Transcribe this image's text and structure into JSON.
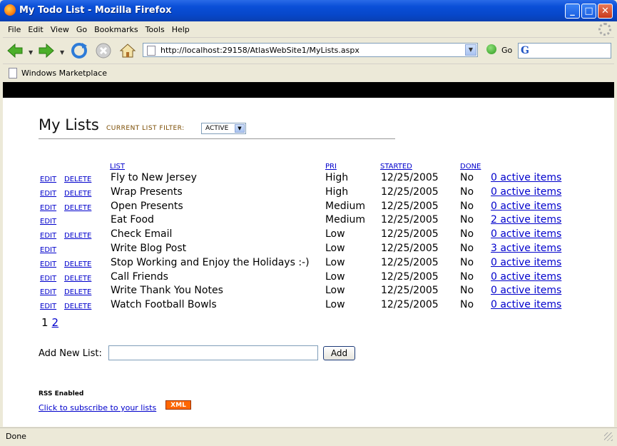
{
  "window": {
    "title": "My Todo List - Mozilla Firefox"
  },
  "menu": [
    "File",
    "Edit",
    "View",
    "Go",
    "Bookmarks",
    "Tools",
    "Help"
  ],
  "nav": {
    "url": "http://localhost:29158/AtlasWebSite1/MyLists.aspx",
    "go_label": "Go"
  },
  "bookmarks": {
    "item": "Windows Marketplace"
  },
  "page": {
    "title": "My Lists",
    "filter_label": "CURRENT LIST FILTER:",
    "filter_value": "ACTIVE",
    "columns": {
      "list": "LIST",
      "pri": "PRI",
      "started": "STARTED",
      "done": "DONE"
    },
    "edit_label": "EDIT",
    "delete_label": "DELETE",
    "rows": [
      {
        "name": "Fly to New Jersey",
        "pri": "High",
        "started": "12/25/2005",
        "done": "No",
        "items": "0 active items",
        "deletable": true
      },
      {
        "name": "Wrap Presents",
        "pri": "High",
        "started": "12/25/2005",
        "done": "No",
        "items": "0 active items",
        "deletable": true
      },
      {
        "name": "Open Presents",
        "pri": "Medium",
        "started": "12/25/2005",
        "done": "No",
        "items": "0 active items",
        "deletable": true
      },
      {
        "name": "Eat Food",
        "pri": "Medium",
        "started": "12/25/2005",
        "done": "No",
        "items": "2 active items",
        "deletable": false
      },
      {
        "name": "Check Email",
        "pri": "Low",
        "started": "12/25/2005",
        "done": "No",
        "items": "0 active items",
        "deletable": true
      },
      {
        "name": "Write Blog Post",
        "pri": "Low",
        "started": "12/25/2005",
        "done": "No",
        "items": "3 active items",
        "deletable": false
      },
      {
        "name": "Stop Working and Enjoy the Holidays :-)",
        "pri": "Low",
        "started": "12/25/2005",
        "done": "No",
        "items": "0 active items",
        "deletable": true
      },
      {
        "name": "Call Friends",
        "pri": "Low",
        "started": "12/25/2005",
        "done": "No",
        "items": "0 active items",
        "deletable": true
      },
      {
        "name": "Write Thank You Notes",
        "pri": "Low",
        "started": "12/25/2005",
        "done": "No",
        "items": "0 active items",
        "deletable": true
      },
      {
        "name": "Watch Football Bowls",
        "pri": "Low",
        "started": "12/25/2005",
        "done": "No",
        "items": "0 active items",
        "deletable": true
      }
    ],
    "pager": {
      "current": "1",
      "next": "2"
    },
    "add_label": "Add New List:",
    "add_button": "Add",
    "rss_label": "RSS Enabled",
    "subscribe_link": "Click to subscribe to your lists",
    "xml_badge": "XML"
  },
  "status": {
    "text": "Done"
  },
  "colors": {
    "link": "#0000cc",
    "titlebar": "#0a4fd8",
    "xml_badge": "#ff6600"
  }
}
